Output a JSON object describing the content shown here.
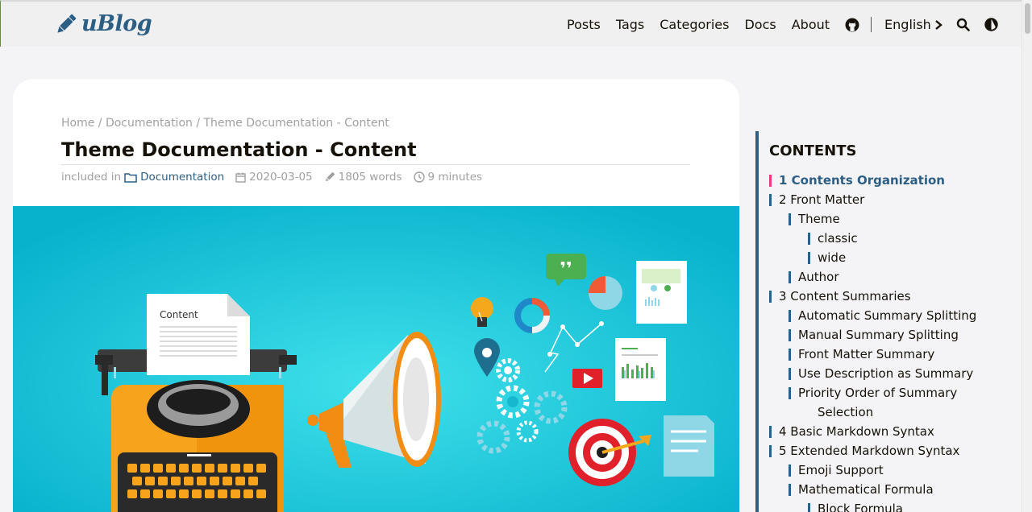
{
  "header": {
    "logo_text": "uBlog",
    "nav": [
      "Posts",
      "Tags",
      "Categories",
      "Docs",
      "About"
    ],
    "language": "English",
    "icons": [
      "pencil-icon",
      "github-icon",
      "chevron-right-icon",
      "search-icon",
      "theme-toggle-icon"
    ]
  },
  "post": {
    "breadcrumb": "Home / Documentation / Theme Documentation - Content",
    "title": "Theme Documentation - Content",
    "meta": {
      "included_in": "included in",
      "category": "Documentation",
      "date": "2020-03-05",
      "words": "1805 words",
      "reading_time": "9 minutes"
    },
    "hero": {
      "paper_label": "Content"
    }
  },
  "toc": {
    "title": "CONTENTS",
    "items": [
      {
        "text": "1 Contents Organization",
        "level": 1,
        "active": true
      },
      {
        "text": "2 Front Matter",
        "level": 1
      },
      {
        "text": "Theme",
        "level": 2
      },
      {
        "text": "classic",
        "level": 3
      },
      {
        "text": "wide",
        "level": 3
      },
      {
        "text": "Author",
        "level": 2
      },
      {
        "text": "3 Content Summaries",
        "level": 1
      },
      {
        "text": "Automatic Summary Splitting",
        "level": 2
      },
      {
        "text": "Manual Summary Splitting",
        "level": 2
      },
      {
        "text": "Front Matter Summary",
        "level": 2
      },
      {
        "text": "Use Description as Summary",
        "level": 2
      },
      {
        "text": "Priority Order of Summary",
        "level": 2
      },
      {
        "text": "Selection",
        "level": 2,
        "continuation": true
      },
      {
        "text": "4 Basic Markdown Syntax",
        "level": 1
      },
      {
        "text": "5 Extended Markdown Syntax",
        "level": 1
      },
      {
        "text": "Emoji Support",
        "level": 2
      },
      {
        "text": "Mathematical Formula",
        "level": 2
      },
      {
        "text": "Block Formula",
        "level": 3
      }
    ]
  },
  "colors": {
    "accent": "#2d5e84",
    "active_marker": "#ef3982",
    "hero_background": "#16b8cf"
  }
}
